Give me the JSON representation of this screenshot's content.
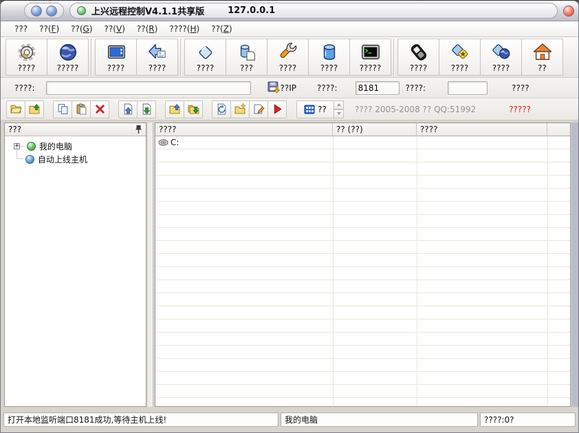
{
  "window": {
    "title": "上兴远程控制V4.1.1共享版",
    "ip": "127.0.0.1"
  },
  "menu": {
    "items": [
      {
        "pre": "???",
        "key": "",
        "post": ""
      },
      {
        "pre": "??(",
        "key": "F",
        "post": ")"
      },
      {
        "pre": "??(",
        "key": "G",
        "post": ")"
      },
      {
        "pre": "??(",
        "key": "V",
        "post": ")"
      },
      {
        "pre": "??(",
        "key": "R",
        "post": ")"
      },
      {
        "pre": "????(",
        "key": "H",
        "post": ")"
      },
      {
        "pre": "??(",
        "key": "Z",
        "post": ")"
      }
    ]
  },
  "toolbar": {
    "buttons": [
      {
        "icon": "gear-icon",
        "label": "????"
      },
      {
        "icon": "globe-icon",
        "label": "?????"
      },
      {
        "icon": "screen-icon",
        "label": "????"
      },
      {
        "icon": "back-image-icon",
        "label": "????"
      },
      {
        "icon": "file-diamond-icon",
        "label": "????"
      },
      {
        "icon": "storage-page-icon",
        "label": "???"
      },
      {
        "icon": "wrench-icon",
        "label": "????"
      },
      {
        "icon": "database-icon",
        "label": "????"
      },
      {
        "icon": "terminal-icon",
        "label": "?????"
      },
      {
        "icon": "device-icon",
        "label": "????"
      },
      {
        "icon": "plugin-star-icon",
        "label": "????"
      },
      {
        "icon": "plugin-globe-icon",
        "label": "????"
      },
      {
        "icon": "home-icon",
        "label": "??"
      }
    ]
  },
  "connection_bar": {
    "service_label": "????:",
    "service_value": "",
    "save_ip_label": "??IP",
    "port_label": "????:",
    "port_value": "8181",
    "password_label": "????:",
    "password_value": "",
    "apply_label": "????"
  },
  "file_toolbar": {
    "view_label": "??",
    "copyright": "???? 2005-2008 ?? QQ:51992",
    "register_label": "?????"
  },
  "sidebar": {
    "header": "???",
    "expand_glyph": "+",
    "tree": [
      {
        "label": "我的电脑"
      },
      {
        "label": "自动上线主机"
      }
    ]
  },
  "table": {
    "columns": [
      "????",
      "?? (??)",
      "????",
      ""
    ],
    "rows": [
      {
        "name": "C:",
        "size": "",
        "type": ""
      }
    ]
  },
  "statusbar": {
    "left": "打开本地监听端口8181成功,等待主机上线!",
    "center": "我的电脑",
    "right": "????:0?"
  }
}
